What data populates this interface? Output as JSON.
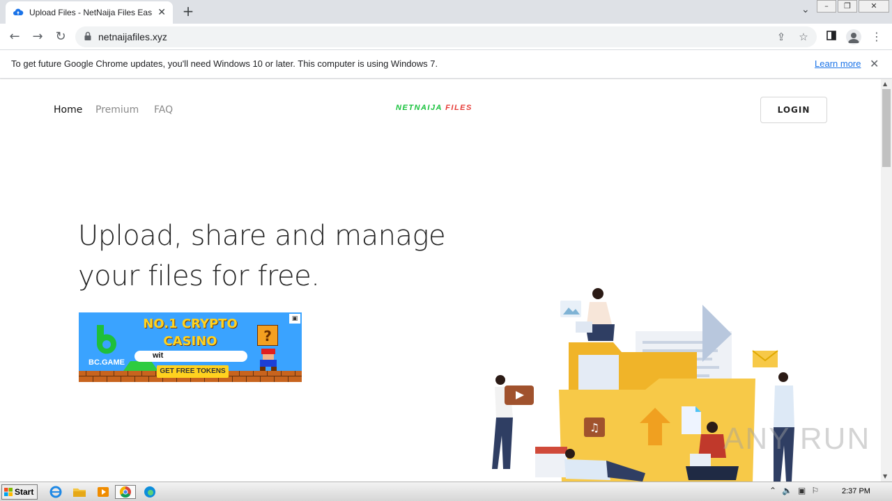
{
  "browser": {
    "tab_title": "Upload Files - NetNaija Files Easy Ac",
    "url": "netnaijafiles.xyz"
  },
  "infobar": {
    "message": "To get future Google Chrome updates, you'll need Windows 10 or later. This computer is using Windows 7.",
    "learn_more": "Learn more"
  },
  "site": {
    "nav": [
      "Home",
      "Premium",
      "FAQ"
    ],
    "logo_part1": "NETNAIJA",
    "logo_part2": "FILES",
    "login_label": "LOGIN",
    "hero_line1": "Upload, share and manage",
    "hero_line2": "your files for free."
  },
  "ad": {
    "title_line1": "NO.1 CRYPTO",
    "title_line2": "CASINO",
    "brand": "BC.GAME",
    "input_text": "wit",
    "button": "GET FREE TOKENS"
  },
  "watermark": "ANY RUN",
  "taskbar": {
    "start_label": "Start",
    "clock": "2:37 PM"
  },
  "colors": {
    "logo_green": "#15c13a",
    "logo_red": "#e53935",
    "link_blue": "#1a73e8",
    "folder_yellow": "#f7c948"
  }
}
